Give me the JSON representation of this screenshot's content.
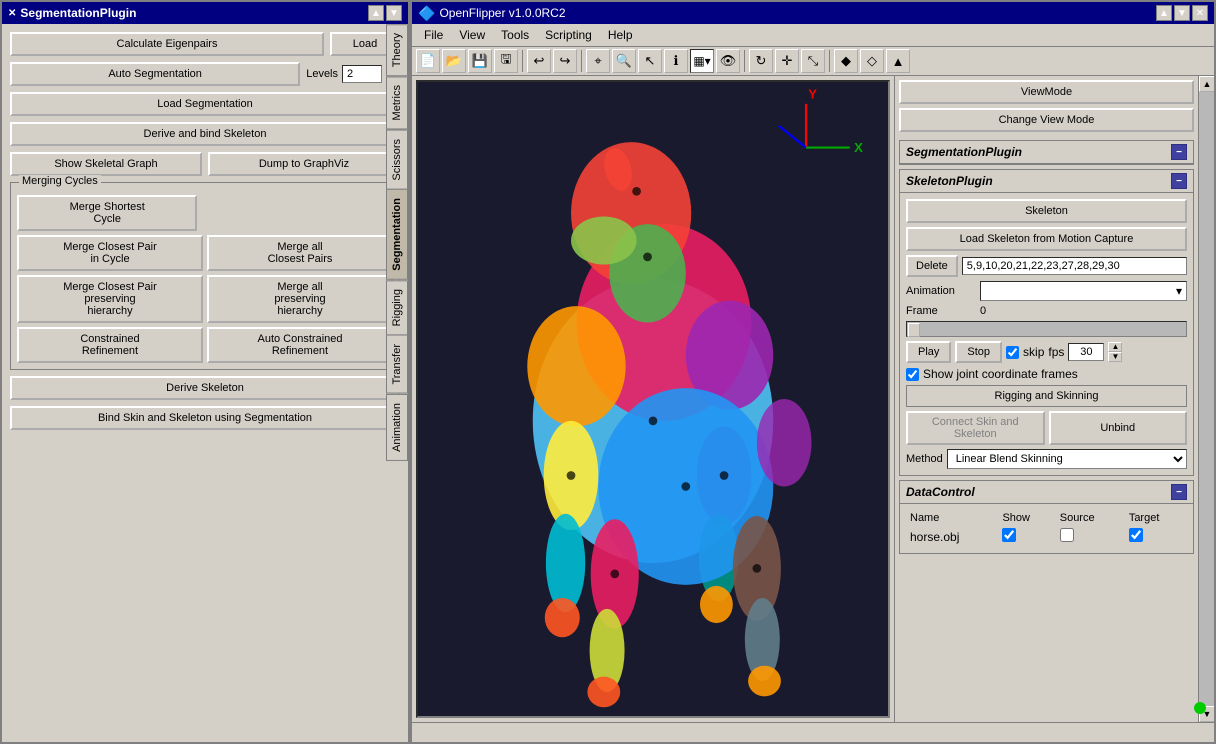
{
  "left_panel": {
    "title": "SegmentationPlugin",
    "buttons": {
      "calculate": "Calculate Eigenpairs",
      "load": "Load",
      "auto_seg": "Auto Segmentation",
      "load_seg": "Load Segmentation",
      "derive_bind": "Derive and bind Skeleton",
      "show_skeletal": "Show Skeletal Graph",
      "dump_graphviz": "Dump to GraphViz",
      "derive_skeleton": "Derive Skeleton",
      "bind_skin": "Bind Skin and Skeleton using Segmentation"
    },
    "levels_label": "Levels",
    "levels_value": "2",
    "merging_cycles": {
      "title": "Merging Cycles",
      "merge_shortest": "Merge Shortest\nCycle",
      "merge_closest_in_cycle": "Merge Closest Pair\nin Cycle",
      "merge_all_closest": "Merge all\nClosest Pairs",
      "merge_closest_hierarchy": "Merge Closest Pair\npreserving\nhierarchy",
      "merge_all_hierarchy": "Merge all\npreserving\nhierarchy",
      "constrained": "Constrained\nRefinement",
      "auto_constrained": "Auto Constrained\nRefinement"
    },
    "tabs": [
      "Theory",
      "Metrics",
      "Scissors",
      "Segmentation",
      "Rigging",
      "Transfer",
      "Animation"
    ]
  },
  "main_window": {
    "title": "OpenFlipper v1.0.0RC2",
    "menu": {
      "file": "File",
      "view": "View",
      "tools": "Tools",
      "scripting": "Scripting",
      "help": "Help"
    }
  },
  "right_panel": {
    "viewmode_btn": "ViewMode",
    "change_viewmode_btn": "Change View Mode",
    "segmentation_plugin": {
      "title": "SegmentationPlugin"
    },
    "skeleton_plugin": {
      "title": "SkeletonPlugin",
      "skeleton_btn": "Skeleton",
      "load_skeleton_btn": "Load Skeleton from Motion Capture",
      "delete_label": "Delete",
      "delete_value": "5,9,10,20,21,22,23,27,28,29,30",
      "animation_label": "Animation",
      "animation_value": "",
      "frame_label": "Frame",
      "frame_value": "0",
      "play_btn": "Play",
      "stop_btn": "Stop",
      "skip_label": "skip",
      "fps_label": "fps",
      "fps_value": "30",
      "show_joints_label": "Show joint coordinate frames"
    },
    "rigging": {
      "title": "Rigging and Skinning",
      "connect_btn": "Connect Skin and Skeleton",
      "unbind_btn": "Unbind",
      "method_label": "Method",
      "method_value": "Linear Blend Skinning"
    },
    "data_control": {
      "title": "DataControl",
      "columns": [
        "Name",
        "Show",
        "Source",
        "Target"
      ],
      "rows": [
        {
          "name": "horse.obj",
          "show": true,
          "source": false,
          "target": true
        }
      ]
    }
  },
  "status_bar": {
    "green_dot": "●"
  }
}
